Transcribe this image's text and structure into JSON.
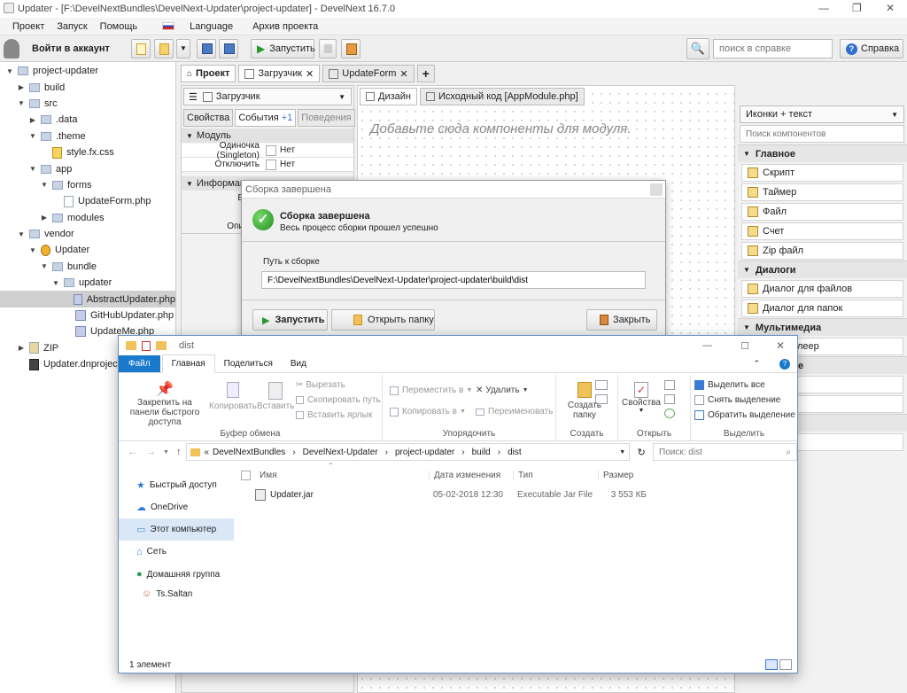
{
  "window": {
    "title": "Updater - [F:\\DevelNextBundles\\DevelNext-Updater\\project-updater] - DevelNext 16.7.0",
    "minimize": "—",
    "maximize": "❐",
    "close": "✕"
  },
  "menu": [
    "Проект",
    "Запуск",
    "Помощь",
    "Language",
    "Архив проекта"
  ],
  "toolbar": {
    "login": "Войти в аккаунт",
    "run": "Запустить",
    "search_placeholder": "поиск в справке",
    "help": "Справка"
  },
  "tree": [
    {
      "label": "project-updater",
      "depth": 0,
      "arrow": "▼",
      "kind": "project"
    },
    {
      "label": "build",
      "depth": 1,
      "arrow": "▶",
      "kind": "folder"
    },
    {
      "label": "src",
      "depth": 1,
      "arrow": "▼",
      "kind": "folder"
    },
    {
      "label": ".data",
      "depth": 2,
      "arrow": "▶",
      "kind": "folder"
    },
    {
      "label": ".theme",
      "depth": 2,
      "arrow": "▼",
      "kind": "folder"
    },
    {
      "label": "style.fx.css",
      "depth": 3,
      "arrow": "",
      "kind": "css"
    },
    {
      "label": "app",
      "depth": 2,
      "arrow": "▼",
      "kind": "folder"
    },
    {
      "label": "forms",
      "depth": 3,
      "arrow": "▼",
      "kind": "folder"
    },
    {
      "label": "UpdateForm.php",
      "depth": 4,
      "arrow": "",
      "kind": "file"
    },
    {
      "label": "modules",
      "depth": 3,
      "arrow": "▶",
      "kind": "folder"
    },
    {
      "label": "vendor",
      "depth": 1,
      "arrow": "▼",
      "kind": "folder"
    },
    {
      "label": "Updater",
      "depth": 2,
      "arrow": "▼",
      "kind": "pkg"
    },
    {
      "label": "bundle",
      "depth": 3,
      "arrow": "▼",
      "kind": "folder"
    },
    {
      "label": "updater",
      "depth": 4,
      "arrow": "▼",
      "kind": "folder"
    },
    {
      "label": "AbstractUpdater.php",
      "depth": 5,
      "arrow": "",
      "kind": "php",
      "selected": true
    },
    {
      "label": "GitHubUpdater.php",
      "depth": 5,
      "arrow": "",
      "kind": "php"
    },
    {
      "label": "UpdateMe.php",
      "depth": 5,
      "arrow": "",
      "kind": "php"
    },
    {
      "label": "ZIP",
      "depth": 1,
      "arrow": "▶",
      "kind": "zip"
    },
    {
      "label": "Updater.dnproject",
      "depth": 1,
      "arrow": "",
      "kind": "home"
    }
  ],
  "tabs": [
    {
      "label": "Проект",
      "active": true,
      "close": false
    },
    {
      "label": "Загрузчик",
      "active": false,
      "close": true
    },
    {
      "label": "UpdateForm",
      "active": false,
      "close": true
    }
  ],
  "props": {
    "module_select": "Загрузчик",
    "subtabs": [
      "Свойства",
      "События",
      "Поведения"
    ],
    "events_badge": "+1",
    "section_module": "Модуль",
    "rows": [
      {
        "label": "Одиночка (Singleton)",
        "value": "Нет"
      },
      {
        "label": "Отключить",
        "value": "Нет"
      }
    ],
    "section_info": "Информация",
    "info_rows": [
      "В",
      "Опи"
    ]
  },
  "design": {
    "subtabs": [
      "Дизайн",
      "Исходный код [AppModule.php]"
    ],
    "placeholder": "Добавьте сюда компоненты для модуля."
  },
  "palette": {
    "mode": "Иконки + текст",
    "search_placeholder": "Поиск компонентов",
    "sections": [
      {
        "title": "Главное",
        "items": [
          "Скрипт",
          "Таймер",
          "Файл",
          "Счет",
          "Zip файл"
        ]
      },
      {
        "title": "Диалоги",
        "items": [
          "Диалог для файлов",
          "Диалог для папок"
        ]
      }
    ],
    "partial_section": "Мультимедиа",
    "partial_item": "леер",
    "partial_e": "е"
  },
  "build_dialog": {
    "title": "Сборка завершена",
    "heading": "Сборка завершена",
    "subheading": "Весь процесс сборки прошел успешно",
    "path_label": "Путь к сборке",
    "path": "F:\\DevelNextBundles\\DevelNext-Updater\\project-updater\\build\\dist",
    "run": "Запустить",
    "open_folder": "Открыть папку",
    "close": "Закрыть"
  },
  "explorer": {
    "title": "dist",
    "ribbon_tabs": [
      "Файл",
      "Главная",
      "Поделиться",
      "Вид"
    ],
    "clipboard": {
      "pin": "Закрепить на панели быстрого доступа",
      "copy": "Копировать",
      "paste": "Вставить",
      "cut": "Вырезать",
      "copy_path": "Скопировать путь",
      "paste_shortcut": "Вставить ярлык",
      "label": "Буфер обмена"
    },
    "organize": {
      "move": "Переместить в",
      "copy": "Копировать в",
      "delete": "Удалить",
      "rename": "Переименовать",
      "label": "Упорядочить"
    },
    "create": {
      "new_folder": "Создать папку",
      "label": "Создать"
    },
    "open": {
      "properties": "Свойства",
      "label": "Открыть"
    },
    "select": {
      "all": "Выделить все",
      "none": "Снять выделение",
      "invert": "Обратить выделение",
      "label": "Выделить"
    },
    "breadcrumb": [
      "DevelNextBundles",
      "DevelNext-Updater",
      "project-updater",
      "build",
      "dist"
    ],
    "search_placeholder": "Поиск: dist",
    "nav": [
      "Быстрый доступ",
      "OneDrive",
      "Этот компьютер",
      "Сеть",
      "Домашняя группа",
      "Ts.Saltan"
    ],
    "columns": [
      "Имя",
      "Дата изменения",
      "Тип",
      "Размер"
    ],
    "files": [
      {
        "name": "Updater.jar",
        "date": "05-02-2018 12:30",
        "type": "Executable Jar File",
        "size": "3 553 КБ"
      }
    ],
    "status": "1 элемент"
  }
}
